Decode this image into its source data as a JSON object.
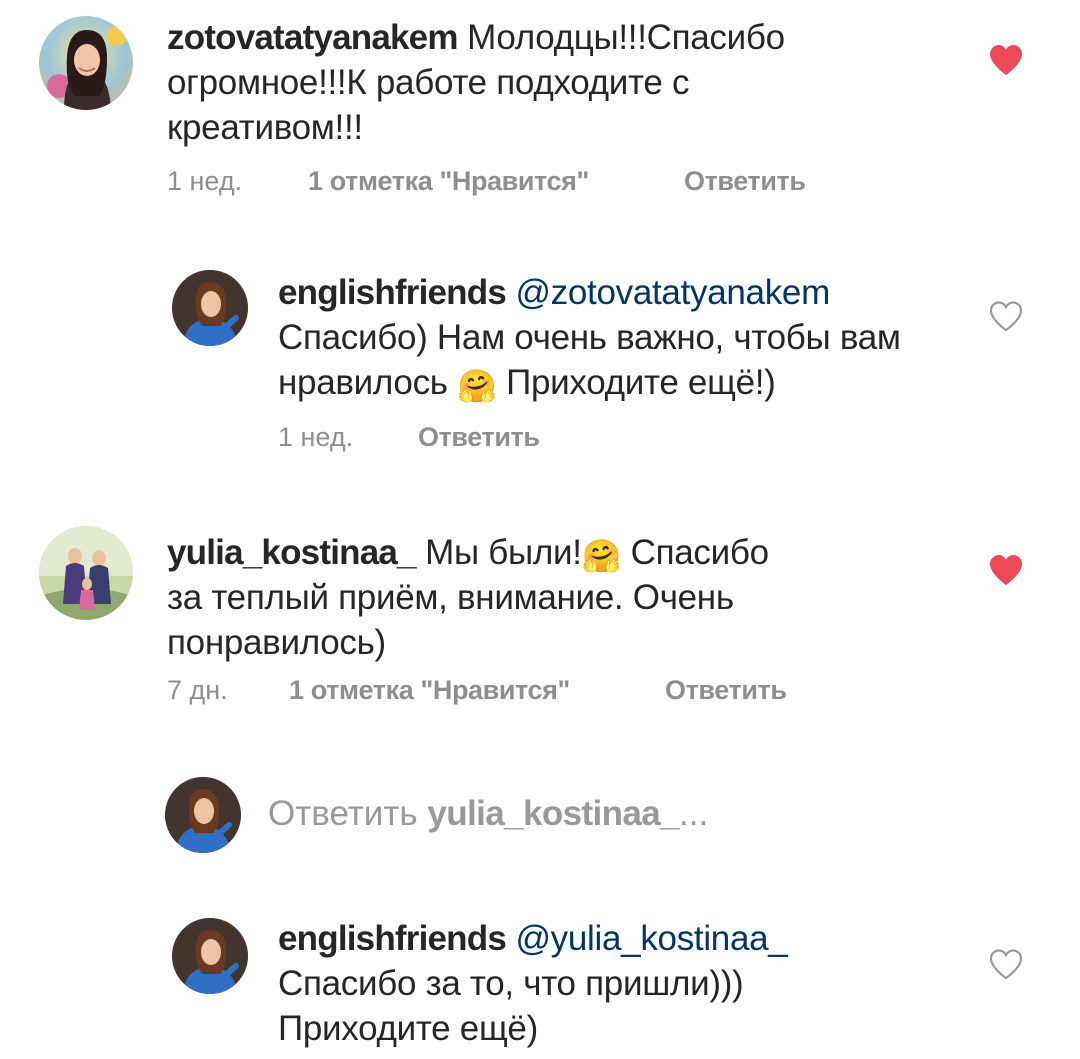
{
  "comments": [
    {
      "username": "zotovatatyanakem",
      "text_line1": " Молодцы!!!Спасибо",
      "text_line2": "огромное!!!К работе подходите с",
      "text_line3": "креативом!!!",
      "time": "1 нед.",
      "likes": "1 отметка \"Нравится\"",
      "reply": "Ответить",
      "liked": true,
      "heart_color": "#ed4956"
    },
    {
      "username": "englishfriends",
      "mention": "@zotovatatyanakem",
      "text_line2": "Спасибо) Нам очень важно, чтобы вам",
      "text_line3a": "нравилось ",
      "emoji": "🤗",
      "text_line3b": " Приходите ещё!)",
      "time": "1 нед.",
      "reply": "Ответить",
      "liked": false
    },
    {
      "username": "yulia_kostinaa_",
      "text_line1a": " Мы были!",
      "emoji": "🤗",
      "text_line1b": " Спасибо",
      "text_line2": "за теплый приём, внимание. Очень",
      "text_line3": "понравилось)",
      "time": "7 дн.",
      "likes": "1 отметка \"Нравится\"",
      "reply": "Ответить",
      "liked": true,
      "heart_color": "#ed4956"
    },
    {
      "username": "englishfriends",
      "mention": "@yulia_kostinaa_",
      "text_line2": "Спасибо за то, что пришли)))",
      "text_line3": "Приходите ещё)",
      "liked": false
    }
  ],
  "reply_box": {
    "prefix": "Ответить ",
    "target": "yulia_kostinaa_",
    "ellipsis": "..."
  },
  "colors": {
    "text": "#262626",
    "meta": "#8e8e8e",
    "mention": "#003569",
    "heart_liked": "#ed4956",
    "heart_outline": "#999999"
  }
}
